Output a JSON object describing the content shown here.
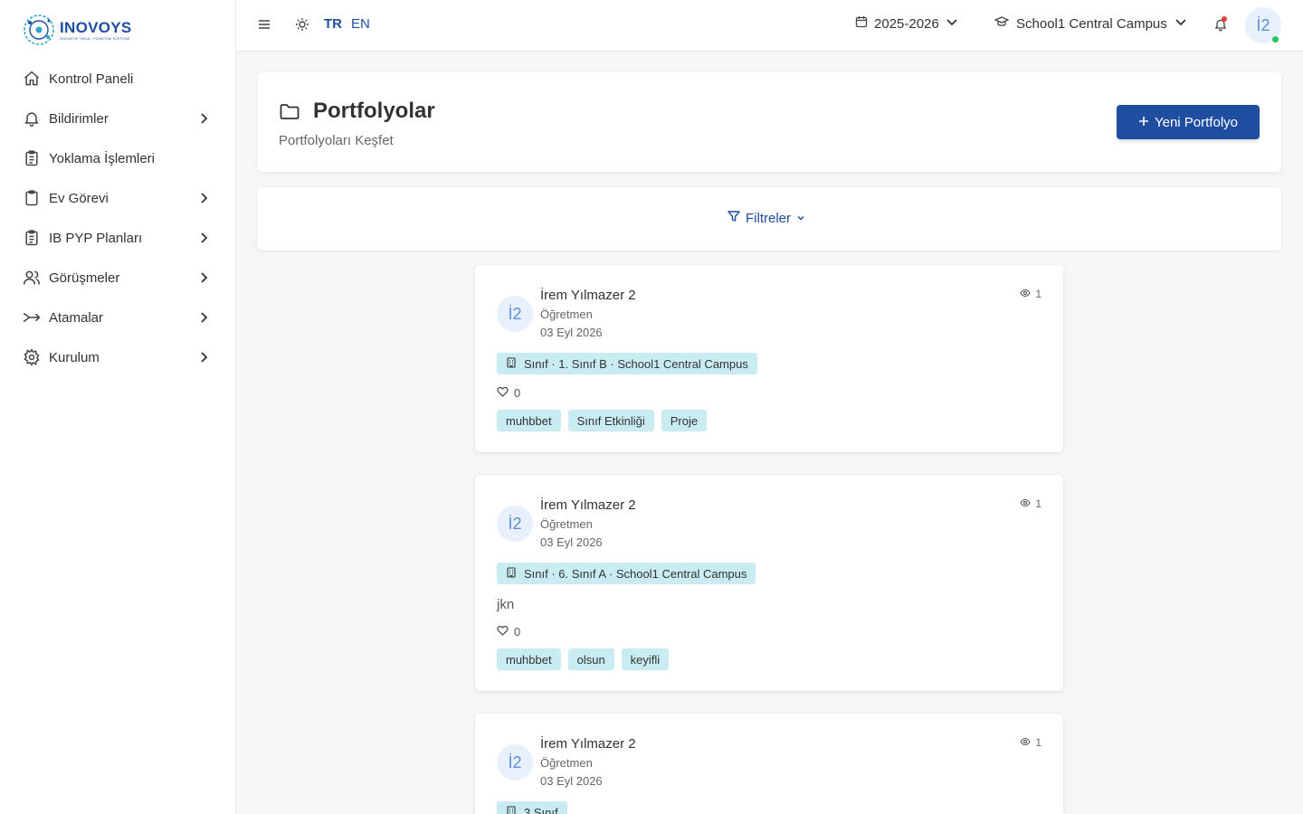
{
  "brand": {
    "name": "INOVOYS",
    "tagline": "İNOVATİF OKUL YÖNETİM SİSTEMİ"
  },
  "sidebar": {
    "items": [
      {
        "label": "Kontrol Paneli",
        "icon": "home-icon",
        "expandable": false
      },
      {
        "label": "Bildirimler",
        "icon": "bell-icon",
        "expandable": true
      },
      {
        "label": "Yoklama İşlemleri",
        "icon": "clipboard-list-icon",
        "expandable": false
      },
      {
        "label": "Ev Görevi",
        "icon": "clipboard-icon",
        "expandable": true
      },
      {
        "label": "IB PYP Planları",
        "icon": "clipboard-list-icon",
        "expandable": true
      },
      {
        "label": "Görüşmeler",
        "icon": "users-icon",
        "expandable": true
      },
      {
        "label": "Atamalar",
        "icon": "merge-arrow-icon",
        "expandable": true
      },
      {
        "label": "Kurulum",
        "icon": "gear-icon",
        "expandable": true
      }
    ]
  },
  "topbar": {
    "lang_tr": "TR",
    "lang_en": "EN",
    "year": "2025-2026",
    "campus": "School1 Central Campus",
    "avatar": "İ2"
  },
  "header": {
    "title": "Portfolyolar",
    "subtitle": "Portfolyoları Keşfet",
    "new_button": "Yeni Portfolyo"
  },
  "filters": {
    "label": "Filtreler"
  },
  "portfolios": [
    {
      "avatar": "İ2",
      "name": "İrem Yılmazer 2",
      "role": "Öğretmen",
      "date": "03 Eyl 2026",
      "views": "1",
      "class": "Sınıf · 1. Sınıf B · School1 Central Campus",
      "description": "",
      "likes": "0",
      "tags": [
        "muhbbet",
        "Sınıf Etkinliği",
        "Proje"
      ]
    },
    {
      "avatar": "İ2",
      "name": "İrem Yılmazer 2",
      "role": "Öğretmen",
      "date": "03 Eyl 2026",
      "views": "1",
      "class": "Sınıf · 6. Sınıf A · School1 Central Campus",
      "description": "jkn",
      "likes": "0",
      "tags": [
        "muhbbet",
        "olsun",
        "keyifli"
      ]
    },
    {
      "avatar": "İ2",
      "name": "İrem Yılmazer 2",
      "role": "Öğretmen",
      "date": "03 Eyl 2026",
      "views": "1",
      "class": "3.Sınıf",
      "description": "",
      "likes": "",
      "tags": []
    }
  ],
  "colors": {
    "primary": "#1f4ea1",
    "tag_bg": "#c8ecf2",
    "online": "#22c55e",
    "alert": "#e53e3e"
  }
}
